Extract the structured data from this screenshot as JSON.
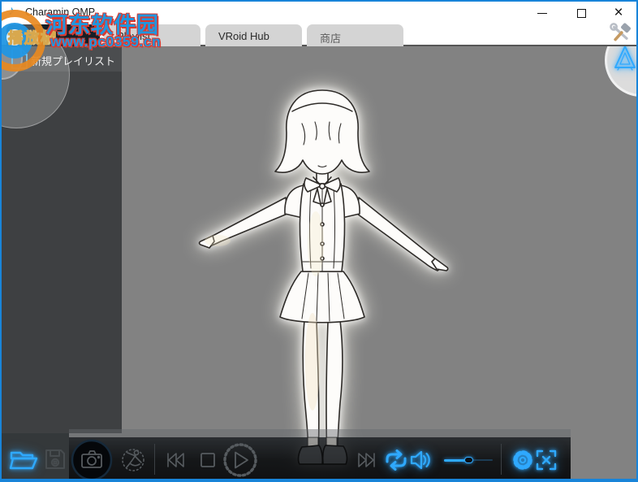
{
  "window": {
    "title": "Charamin OMP",
    "app_icon": "music-note-icon"
  },
  "window_controls": {
    "minimize": "minimize-icon",
    "maximize": "maximize-icon",
    "close_glyph": "×"
  },
  "tabs": [
    {
      "label": "播放机",
      "selected": true
    },
    {
      "label": "Playlist",
      "selected": false
    },
    {
      "label": "VRoid Hub",
      "selected": false
    },
    {
      "label": "商店",
      "selected": false
    }
  ],
  "toolbar": {
    "tools_icon": "hammer-wrench-icon"
  },
  "sidebar": {
    "new_playlist_label": "新規プレイリスト",
    "header_icon": "new-document-icon"
  },
  "corner_buttons": {
    "left_icon": "new-document-icon",
    "right_icon": "charamin-triangle-logo-icon"
  },
  "viewport": {
    "content": "3d-anime-girl-character-t-pose"
  },
  "player": {
    "left_buttons": [
      {
        "icon": "open-folder-icon",
        "active": true
      },
      {
        "icon": "save-floppy-icon",
        "active": false
      }
    ],
    "buttons": [
      {
        "icon": "camera-icon",
        "active": false
      },
      {
        "icon": "dance-pose-icon",
        "active": false
      },
      {
        "icon": "previous-track-icon",
        "active": false
      },
      {
        "icon": "stop-icon",
        "active": false
      },
      {
        "icon": "play-gear-icon",
        "active": false
      },
      {
        "icon": "next-track-icon",
        "active": false
      },
      {
        "icon": "repeat-icon",
        "active": true
      },
      {
        "icon": "volume-icon",
        "active": true
      },
      {
        "icon": "settings-gear-icon",
        "active": true
      },
      {
        "icon": "fullscreen-icon",
        "active": true
      }
    ],
    "volume_percent": 50,
    "accent_color": "#2fa9ff"
  },
  "watermark": {
    "site_name": "河东软件园",
    "site_url": "www.pc0359.cn",
    "logo_text": "播放机",
    "text_color": "#1f97e0",
    "outline_color": "#d93a31"
  },
  "colors": {
    "window_border": "#1884d9",
    "viewport_bg": "#828282",
    "sidebar_bg": "#3e4042",
    "sidebar_header_bg": "#4b4d4f",
    "selected_tab_bg": "#151f27",
    "player_bar_bg": "#0a0c0f"
  }
}
